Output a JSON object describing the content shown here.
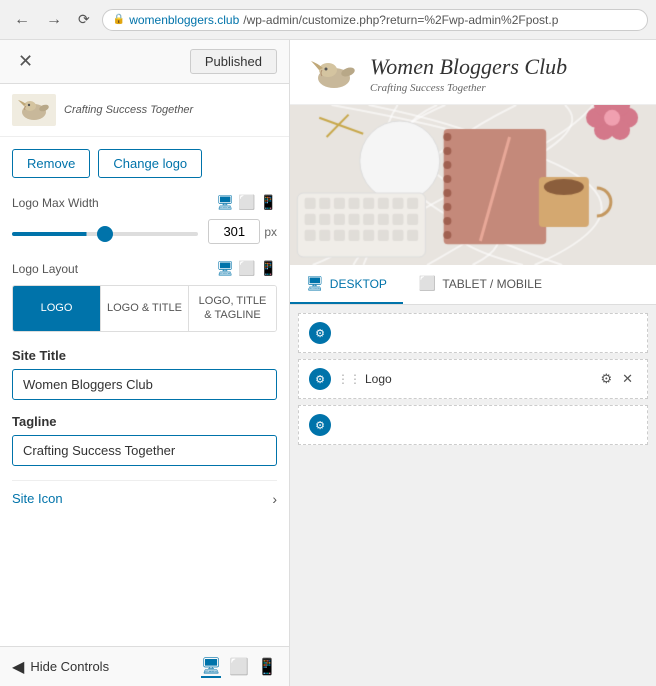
{
  "browser": {
    "back_disabled": false,
    "forward_disabled": false,
    "url_lock": "🔒",
    "url_domain": "womenbloggers.club",
    "url_path": "/wp-admin/customize.php?return=%2Fwp-admin%2Fpost.p"
  },
  "header": {
    "close_label": "✕",
    "published_label": "Published"
  },
  "logo_preview": {
    "tagline": "Crafting Success Together"
  },
  "buttons": {
    "remove_label": "Remove",
    "change_logo_label": "Change logo"
  },
  "logo_max_width": {
    "label": "Logo Max Width",
    "value": 301,
    "px_label": "px"
  },
  "logo_layout": {
    "label": "Logo Layout",
    "options": [
      "LOGO",
      "LOGO & TITLE",
      "LOGO, TITLE & TAGLINE"
    ],
    "active_index": 0
  },
  "site_title": {
    "label": "Site Title",
    "value": "Women Bloggers Club"
  },
  "tagline": {
    "label": "Tagline",
    "value": "Crafting Success Together"
  },
  "site_icon": {
    "label": "Site Icon",
    "chevron": "›"
  },
  "bottom_bar": {
    "hide_label": "Hide Controls",
    "arrow": "◀",
    "device_icons": [
      "🖥",
      "⬜",
      "📱"
    ]
  },
  "preview": {
    "site_title": "Women Bloggers Club",
    "site_tagline": "Crafting Success Together",
    "tabs": [
      {
        "label": "DESKTOP",
        "icon": "🖥",
        "active": true
      },
      {
        "label": "TABLET / MOBILE",
        "icon": "⬜",
        "active": false
      }
    ],
    "widgets": [
      {
        "id": 1,
        "has_label": false
      },
      {
        "id": 2,
        "label": "Logo",
        "has_gear": true,
        "has_close": true
      },
      {
        "id": 3,
        "has_label": false
      }
    ]
  },
  "icons": {
    "gear": "⚙",
    "close": "✕",
    "dots": "⋮⋮"
  }
}
